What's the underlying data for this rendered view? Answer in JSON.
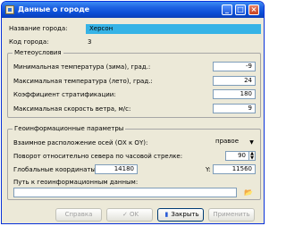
{
  "window": {
    "title": "Данные о городе"
  },
  "titlebar": {
    "minimize": "_",
    "maximize": "□",
    "close": "×"
  },
  "city": {
    "name_label": "Название города:",
    "name_value": "Херсон",
    "code_label": "Код города:",
    "code_value": "3"
  },
  "meteo": {
    "title": "Метеоусловия",
    "min_temp_label": "Минимальная температура (зима), град.:",
    "min_temp_value": "-9",
    "max_temp_label": "Максимальная температура (лето), град.:",
    "max_temp_value": "24",
    "strat_label": "Коэффициент стратификации:",
    "strat_value": "180",
    "wind_label": "Максимальная скорость ветра, м/с:",
    "wind_value": "9"
  },
  "geo": {
    "title": "Геоинформационные параметры",
    "axes_label": "Взаимное расположение осей (ОХ к ОY):",
    "axes_value": "правое",
    "rotation_label": "Поворот относительно севера по часовой стрелке:",
    "rotation_value": "90",
    "coords_label": "Глобальные координаты, X:",
    "x_value": "14180",
    "y_label": "Y:",
    "y_value": "11560",
    "path_label": "Путь к геоинформационным данным:",
    "path_value": ""
  },
  "buttons": {
    "help": "Справка",
    "ok": "OK",
    "close": "Закрыть",
    "apply": "Применить"
  },
  "icons": {
    "window": "app-icon",
    "select_arrow": "chevron-down-icon",
    "spin": "spin-arrows-icon",
    "folder": "folder-open-icon",
    "ok": "checkmark-icon",
    "close": "door-icon"
  }
}
